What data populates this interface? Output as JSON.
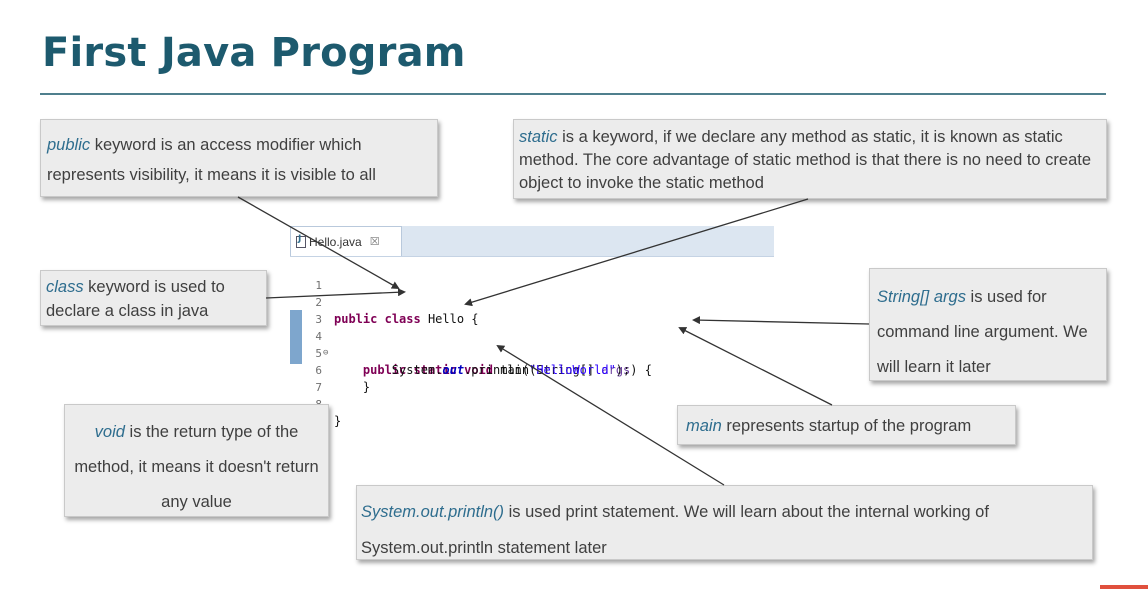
{
  "slide": {
    "title": "First Java Program",
    "accent_color": "#e0503d",
    "title_color": "#1d5a6e"
  },
  "notes": {
    "public": {
      "keyword": "public",
      "text": " keyword is an access modifier which represents visibility, it means it is visible to all"
    },
    "static": {
      "keyword": "static",
      "text": " is a keyword, if we declare any method as static, it is known as static method. The core advantage of static method is that there is no need to create object to invoke the static method"
    },
    "class": {
      "keyword": "class",
      "text": " keyword is used to declare a class in java"
    },
    "string_args": {
      "keyword": "String[] args",
      "text": " is used for command line argument. We will learn it later"
    },
    "void": {
      "keyword": "void",
      "text": " is the return type of the method, it means it doesn't return any value"
    },
    "main": {
      "keyword": "main",
      "text": " represents startup of the program"
    },
    "println": {
      "keyword": "System.out.println()",
      "text": " is used print statement. We will learn about the internal working of System.out.println statement later"
    }
  },
  "editor": {
    "tab_label": "Hello.java",
    "tab_close": "☒",
    "tab_icon": "java-file-icon",
    "fold_marker": "⊖",
    "lines": [
      {
        "num": "1"
      },
      {
        "num": "2",
        "t1": "public",
        "t2": " ",
        "t3": "class",
        "t4": " Hello {"
      },
      {
        "num": "3"
      },
      {
        "num": "4",
        "t1": "    ",
        "t2": "public",
        "t3": " ",
        "t4": "static",
        "t5": " ",
        "t6": "void",
        "t7": " main(String[] ",
        "t8": "args",
        "t9": ") {"
      },
      {
        "num": "5",
        "t1": "        System.",
        "t2": "out",
        "t3": ".println(",
        "t4": "\"HelloWorld\"",
        "t5": ");"
      },
      {
        "num": "6",
        "t1": "    }"
      },
      {
        "num": "7"
      },
      {
        "num": "8",
        "t1": "}"
      }
    ]
  }
}
